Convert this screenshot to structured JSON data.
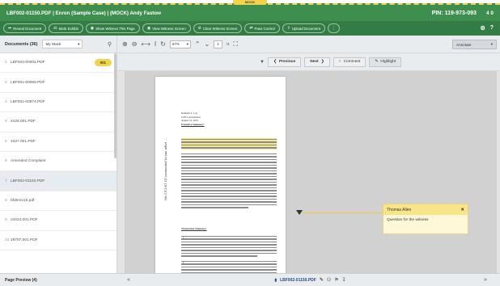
{
  "mock_label": "MOCK",
  "titlebar": {
    "title": "LBF002-01150.PDF | Enron (Sample Case) | (MOCK) Andy Fastow",
    "pin": "PIN: 119-973-093",
    "notifications": "4 0"
  },
  "actions": [
    {
      "icon": "share-icon",
      "glyph": "➦",
      "label": "Reveal Document"
    },
    {
      "icon": "gavel-icon",
      "glyph": "⚖",
      "label": "Mark Exhibit"
    },
    {
      "icon": "eye-icon",
      "glyph": "◉",
      "label": "Show Witness This Page"
    },
    {
      "icon": "eye-icon",
      "glyph": "◉",
      "label": "View Witness Screen"
    },
    {
      "icon": "clear-icon",
      "glyph": "⊘",
      "label": "Clear Witness Screen"
    },
    {
      "icon": "pass-icon",
      "glyph": "⇄",
      "label": "Pass Control"
    },
    {
      "icon": "upload-icon",
      "glyph": "⇧",
      "label": "Upload Document"
    },
    {
      "icon": "more-icon",
      "glyph": "⋮",
      "label": ""
    }
  ],
  "actionbar_right": {
    "settings": "⚙",
    "help": "?"
  },
  "left": {
    "documents_label": "Documents (36)",
    "stack_label": "My Stack",
    "documents": [
      {
        "num": "1",
        "name": "LBF004-00001.PDF",
        "badge": "001"
      },
      {
        "num": "2",
        "name": "LBF001-00069.PDF",
        "badge": ""
      },
      {
        "num": "3",
        "name": "LBF001-00874.PDF",
        "badge": ""
      },
      {
        "num": "4",
        "name": "4426.001.PDF",
        "badge": ""
      },
      {
        "num": "5",
        "name": "4427.001.PDF",
        "badge": ""
      },
      {
        "num": "6",
        "name": "Amended Complaint",
        "badge": ""
      },
      {
        "num": "7",
        "name": "LBF002-01150.PDF",
        "badge": ""
      },
      {
        "num": "8",
        "name": "bfdemo15.pdf",
        "badge": ""
      },
      {
        "num": "9",
        "name": "24024.001.PDF",
        "badge": ""
      },
      {
        "num": "10",
        "name": "28707.001.PDF",
        "badge": ""
      }
    ]
  },
  "viewer": {
    "zoom": "67%",
    "page": "1",
    "of_pages": "/4",
    "annotate": "Annotate",
    "previous": "Previous",
    "next": "Next",
    "comment": "Comment",
    "highlight": "Highlight"
  },
  "memo": {
    "to": "Kenneth L. Lay",
    "from": "Cliff Constellation",
    "date": "August 10, 2001",
    "summary": "Executive Summary:",
    "section": "Transaction Summary:"
  },
  "handwriting": "We 1/15/01 I'll connected to see what ...",
  "comment": {
    "author": "Thomas Allen",
    "text": "Question for the witness"
  },
  "bottom": {
    "preview_label": "Page Preview",
    "preview_count": "(4)",
    "prev": "«",
    "next": "»",
    "filename": "LBF002-01150.PDF"
  },
  "colors": {
    "header_green": "#3e8f4f",
    "toolbar_green": "#347c45",
    "accent_yellow": "#f3d34a"
  }
}
